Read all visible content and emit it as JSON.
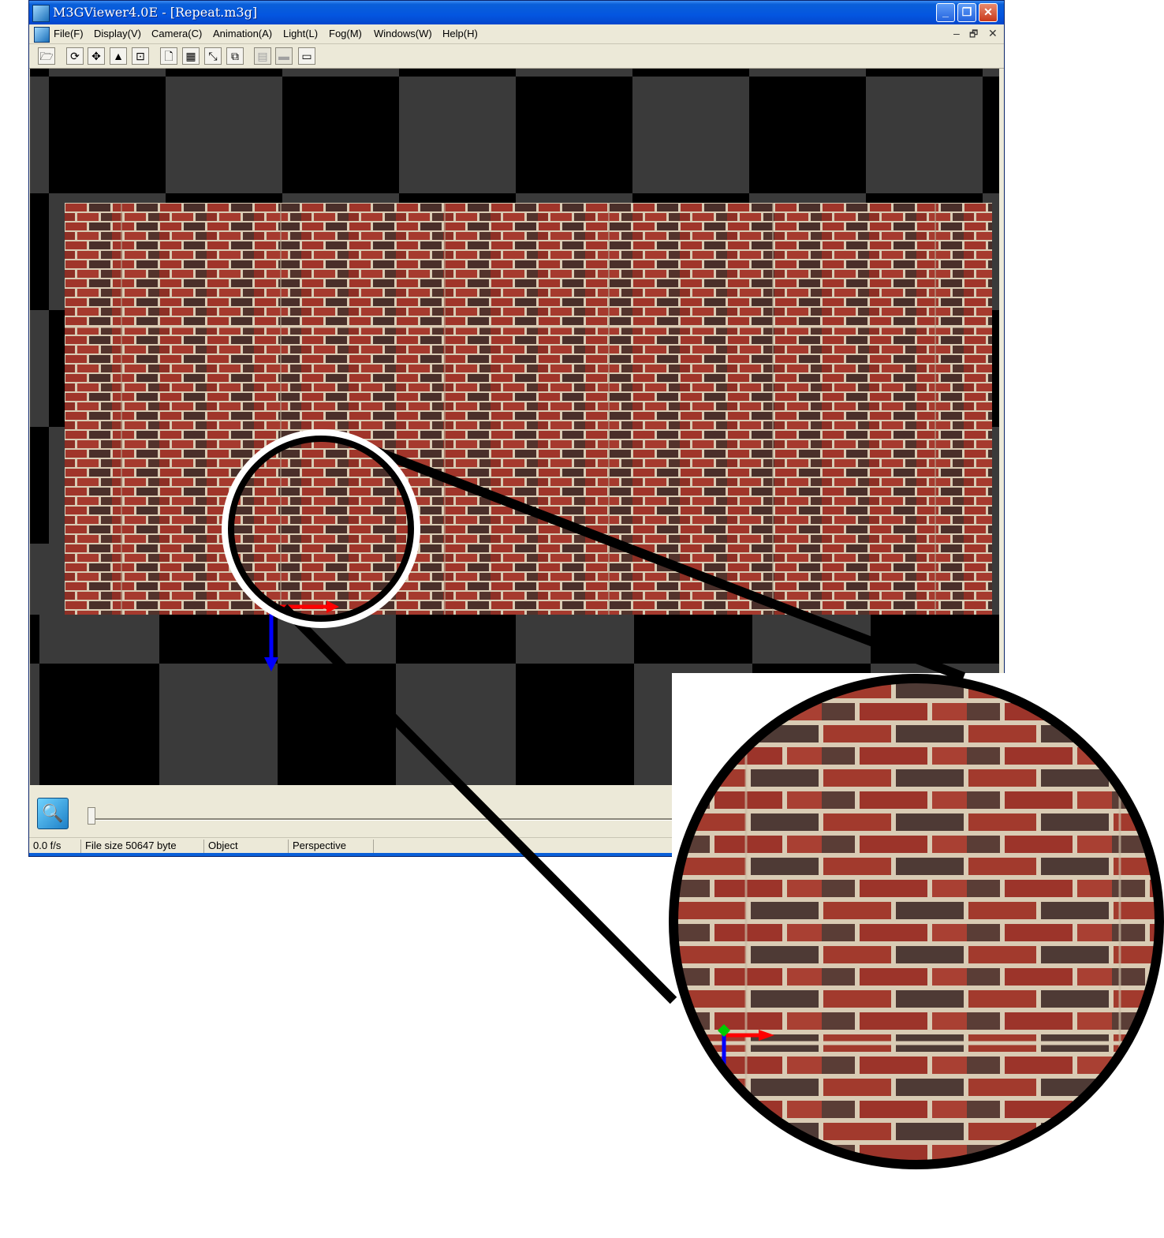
{
  "window": {
    "title": "M3GViewer4.0E  - [Repeat.m3g]",
    "controls": {
      "minimize": "_",
      "maximize": "❐",
      "close": "✕"
    }
  },
  "menubar": {
    "items": [
      "File(F)",
      "Display(V)",
      "Camera(C)",
      "Animation(A)",
      "Light(L)",
      "Fog(M)",
      "Windows(W)",
      "Help(H)"
    ],
    "mdi_controls": {
      "minimize": "–",
      "restore": "🗗",
      "close": "✕"
    }
  },
  "toolbar": {
    "buttons": [
      {
        "icon": "open-folder-icon",
        "glyph": "🗁",
        "enabled": true
      },
      {
        "icon": "rotate-icon",
        "glyph": "⟳",
        "enabled": true
      },
      {
        "icon": "move-icon",
        "glyph": "✥",
        "enabled": true
      },
      {
        "icon": "up-arrow-icon",
        "glyph": "▲",
        "enabled": true
      },
      {
        "icon": "fit-view-icon",
        "glyph": "⊡",
        "enabled": true
      },
      {
        "icon": "page-icon",
        "glyph": "🗋",
        "enabled": true
      },
      {
        "icon": "grid-icon",
        "glyph": "▦",
        "enabled": true
      },
      {
        "icon": "axis-icon",
        "glyph": "⤡",
        "enabled": true
      },
      {
        "icon": "copy-icon",
        "glyph": "⧉",
        "enabled": true
      },
      {
        "icon": "layer-icon",
        "glyph": "▤",
        "enabled": false
      },
      {
        "icon": "gradient-icon",
        "glyph": "▬",
        "enabled": false
      },
      {
        "icon": "film-icon",
        "glyph": "▭",
        "enabled": true
      }
    ]
  },
  "bottom": {
    "play_glyph": "🔍",
    "timeline_position": 0.0
  },
  "status": {
    "fps": "0.0  f/s",
    "file_size": "File size 50647 byte",
    "mode": "Object",
    "projection": "Perspective"
  },
  "colors": {
    "checker_dark": "#3a3a3a",
    "checker_black": "#000000",
    "brick_red": "#a0352a",
    "brick_dark": "#4a2f2a",
    "mortar": "#d9cbb4",
    "axis_x": "#ff0000",
    "axis_y": "#00cc00",
    "axis_z": "#0000ff",
    "titlebar": "#0456e0"
  }
}
